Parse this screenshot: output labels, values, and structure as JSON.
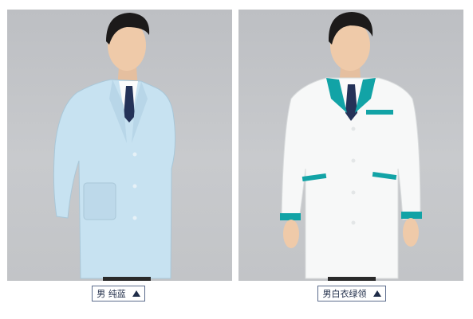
{
  "products": [
    {
      "label": "男 纯蓝",
      "coat_color": "#c7e2f1",
      "trim_color": "#c7e2f1",
      "arrow_icon": "triangle-up-icon"
    },
    {
      "label": "男白衣绿领",
      "coat_color": "#f7f8f8",
      "trim_color": "#12a3a6",
      "arrow_icon": "triangle-up-icon"
    }
  ],
  "colors": {
    "label_border": "#5c6c8c",
    "label_text": "#1f2c48",
    "photo_bg": "#c4c6c9"
  }
}
